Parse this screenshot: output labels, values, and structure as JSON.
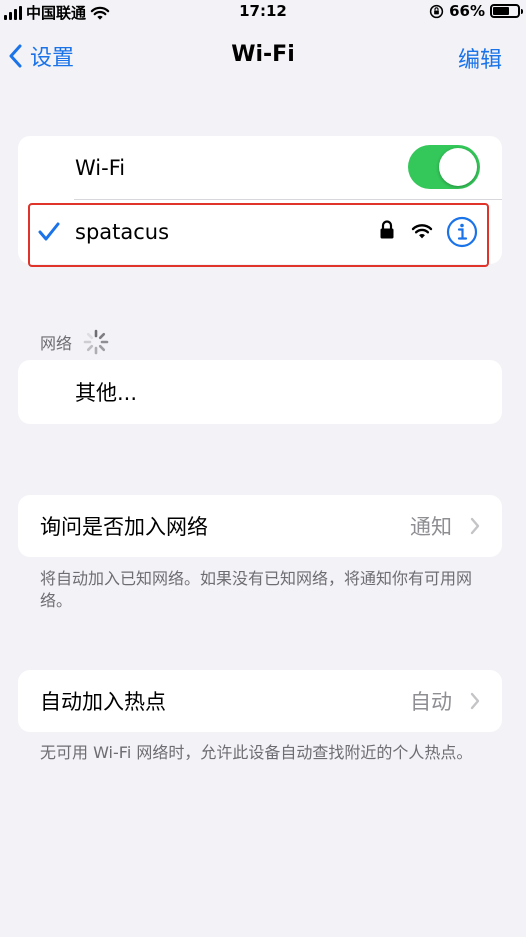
{
  "status_bar": {
    "carrier": "中国联通",
    "time": "17:12",
    "battery_percent": "66%",
    "battery_level": 0.66
  },
  "nav": {
    "back_label": "设置",
    "title": "Wi-Fi",
    "edit_label": "编辑"
  },
  "wifi": {
    "toggle_label": "Wi-Fi",
    "toggle_on": true,
    "connected_network": "spatacus"
  },
  "networks": {
    "section_label": "网络",
    "other_label": "其他..."
  },
  "ask_to_join": {
    "label": "询问是否加入网络",
    "value": "通知",
    "footnote": "将自动加入已知网络。如果没有已知网络，将通知你有可用网络。"
  },
  "auto_join_hotspot": {
    "label": "自动加入热点",
    "value": "自动",
    "footnote": "无可用 Wi-Fi 网络时，允许此设备自动查找附近的个人热点。"
  },
  "colors": {
    "accent": "#1a73e8",
    "toggle_on": "#34c759",
    "highlight": "#e0332a",
    "background": "#f2f2f7"
  }
}
